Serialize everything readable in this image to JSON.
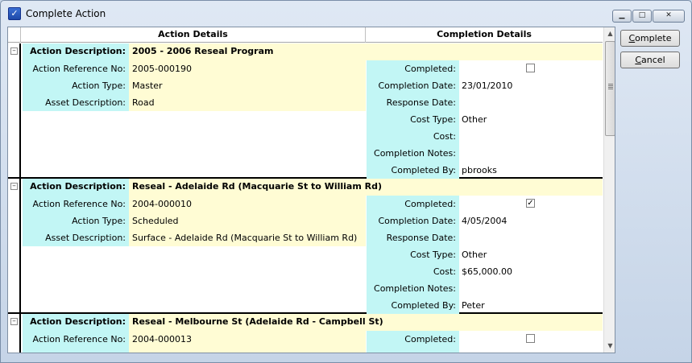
{
  "window": {
    "title": "Complete Action",
    "title_icon": "check-form-icon",
    "controls": [
      "minimize-icon",
      "maximize-icon",
      "close-icon"
    ]
  },
  "grid": {
    "headers": {
      "action": "Action Details",
      "completion": "Completion Details"
    },
    "labels": {
      "action_description": "Action Description:",
      "action_reference": "Action Reference No:",
      "action_type": "Action Type:",
      "asset_description": "Asset Description:",
      "completed": "Completed:",
      "completion_date": "Completion Date:",
      "response_date": "Response Date:",
      "cost_type": "Cost Type:",
      "cost": "Cost:",
      "completion_notes": "Completion Notes:",
      "completed_by": "Completed By:"
    },
    "groups": [
      {
        "description": "2005 - 2006 Reseal Program",
        "reference": "2005-000190",
        "type": "Master",
        "asset": "Road",
        "completed": false,
        "completion_date": "23/01/2010",
        "response_date": "",
        "cost_type": "Other",
        "cost": "",
        "completion_notes": "",
        "completed_by": "pbrooks"
      },
      {
        "description": "Reseal - Adelaide Rd (Macquarie St to William Rd)",
        "reference": "2004-000010",
        "type": "Scheduled",
        "asset": "Surface - Adelaide Rd (Macquarie St to William Rd)",
        "completed": true,
        "completion_date": "4/05/2004",
        "response_date": "",
        "cost_type": "Other",
        "cost": "$65,000.00",
        "completion_notes": "",
        "completed_by": "Peter"
      },
      {
        "description": "Reseal - Melbourne St (Adelaide Rd - Campbell St)",
        "reference": "2004-000013",
        "completed": false
      }
    ]
  },
  "buttons": {
    "complete_first": "C",
    "complete_rest": "omplete",
    "cancel_first": "C",
    "cancel_rest": "ancel"
  },
  "colors": {
    "label_bg": "#c2f6f5",
    "value_bg": "#fffcd4"
  }
}
